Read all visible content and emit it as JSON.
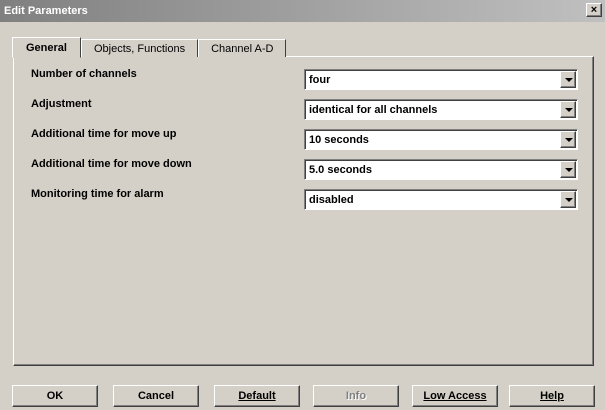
{
  "window": {
    "title": "Edit Parameters",
    "close_glyph": "×"
  },
  "tabs": [
    {
      "label": "General",
      "active": true
    },
    {
      "label": "Objects, Functions",
      "active": false
    },
    {
      "label": "Channel A-D",
      "active": false
    }
  ],
  "parameters": [
    {
      "label": "Number of channels",
      "value": "four"
    },
    {
      "label": "Adjustment",
      "value": "identical for all channels"
    },
    {
      "label": "Additional time for move up",
      "value": "10 seconds"
    },
    {
      "label": "Additional time for move down",
      "value": "5.0 seconds"
    },
    {
      "label": "Monitoring time for alarm",
      "value": "disabled"
    }
  ],
  "buttons": {
    "ok": "OK",
    "cancel": "Cancel",
    "default": "Default",
    "info": "Info",
    "low_access": "Low Access",
    "help": "Help"
  },
  "colors": {
    "face": "#d4d0c8",
    "title_start": "#808080",
    "title_end": "#c0c0c0"
  }
}
